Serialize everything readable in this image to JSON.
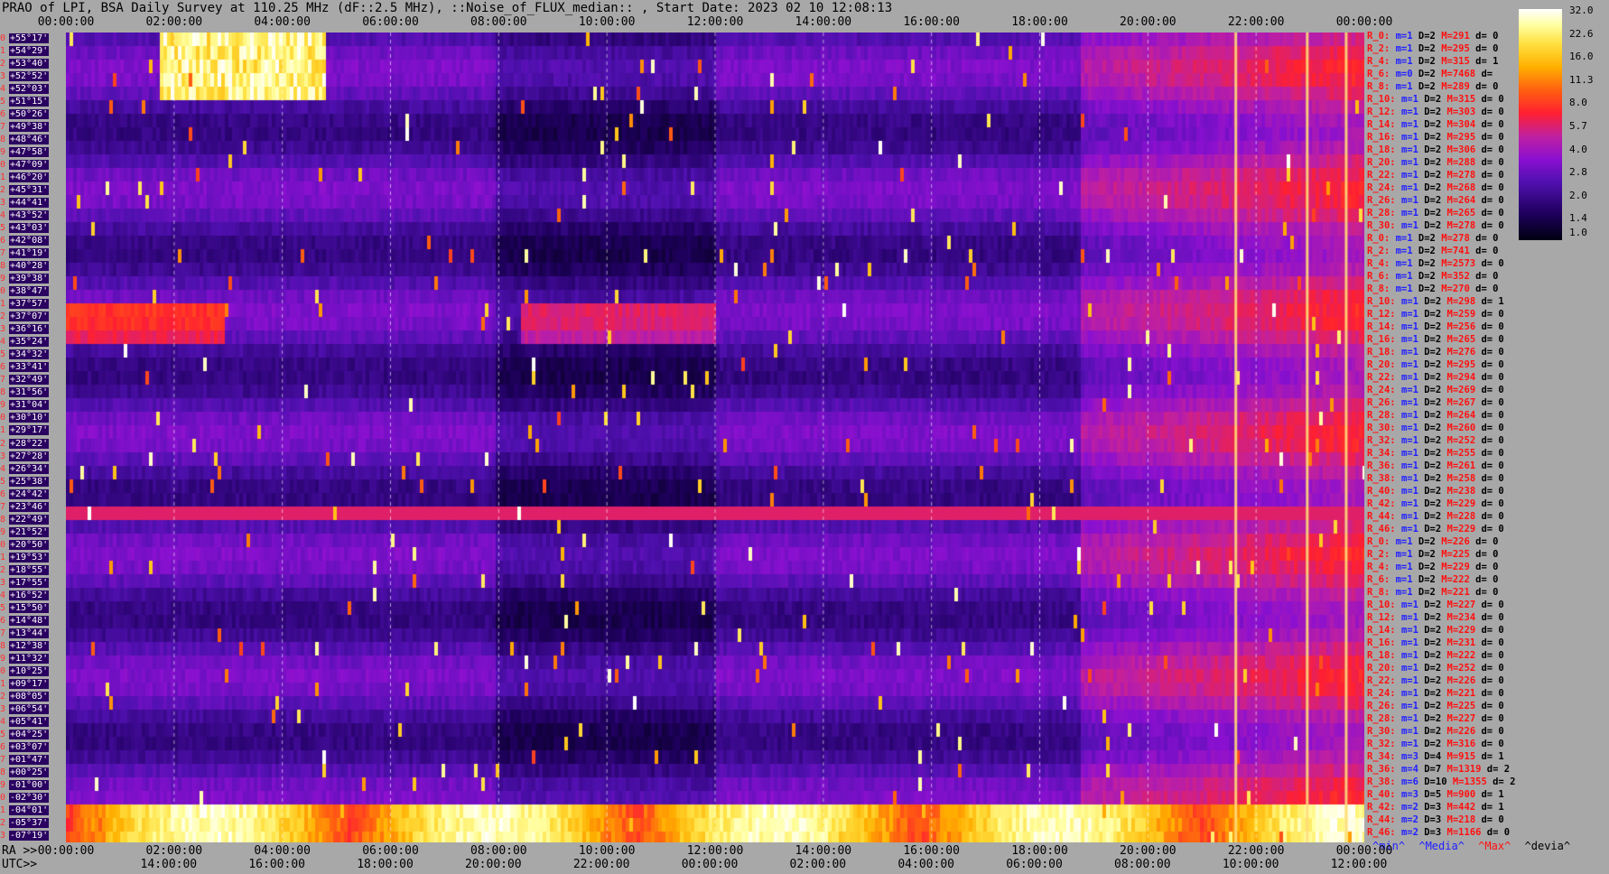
{
  "header": {
    "title": "PRAO of LPI, BSA Daily Survey at 110.25 MHz (dF::2.5 MHz), ::Noise_of_FLUX_median:: , Start Date: 2023 02 10 12:08:13"
  },
  "chart_data": {
    "type": "heatmap",
    "title": "PRAO of LPI, BSA Daily Survey at 110.25 MHz (dF::2.5 MHz), ::Noise_of_FLUX_median:: , Start Date: 2023 02 10 12:08:13",
    "top_time_ticks": [
      "00:00:00",
      "02:00:00",
      "04:00:00",
      "06:00:00",
      "08:00:00",
      "10:00:00",
      "12:00:00",
      "14:00:00",
      "16:00:00",
      "18:00:00",
      "20:00:00",
      "22:00:00",
      "00:00:00"
    ],
    "ra_prefix": "RA >>",
    "ra_ticks": [
      "00:00:00",
      "02:00:00",
      "04:00:00",
      "06:00:00",
      "08:00:00",
      "10:00:00",
      "12:00:00",
      "14:00:00",
      "16:00:00",
      "18:00:00",
      "20:00:00",
      "22:00:00",
      "00:00:00"
    ],
    "utc_prefix": "UTC>>",
    "utc_ticks": [
      "14:00:00",
      "16:00:00",
      "18:00:00",
      "20:00:00",
      "22:00:00",
      "00:00:00",
      "02:00:00",
      "04:00:00",
      "06:00:00",
      "08:00:00",
      "10:00:00",
      "12:00:00"
    ],
    "declinations": [
      "+55°17'",
      "+54°29'",
      "+53°40'",
      "+52°52'",
      "+52°03'",
      "+51°15'",
      "+50°26'",
      "+49°38'",
      "+48°46'",
      "+47°58'",
      "+47°09'",
      "+46°20'",
      "+45°31'",
      "+44°41'",
      "+43°52'",
      "+43°03'",
      "+42°08'",
      "+41°19'",
      "+40°28'",
      "+39°38'",
      "+38°47'",
      "+37°57'",
      "+37°07'",
      "+36°16'",
      "+35°24'",
      "+34°32'",
      "+33°41'",
      "+32°49'",
      "+31°56'",
      "+31°04'",
      "+30°10'",
      "+29°17'",
      "+28°22'",
      "+27°28'",
      "+26°34'",
      "+25°38'",
      "+24°42'",
      "+23°46'",
      "+22°49'",
      "+21°52'",
      "+20°50'",
      "+19°53'",
      "+18°55'",
      "+17°55'",
      "+16°52'",
      "+15°50'",
      "+14°48'",
      "+13°44'",
      "+12°38'",
      "+11°32'",
      "+10°25'",
      "+09°17'",
      "+08°05'",
      "+06°54'",
      "+05°41'",
      "+04°25'",
      "+03°07'",
      "+01°47'",
      "+00°25'",
      "-01°00'",
      "-02°30'",
      "-04°01'",
      "-05°37'",
      "-07°19'"
    ],
    "colorbar": {
      "ticks": [
        "32.0",
        "22.6",
        "16.0",
        "11.3",
        "8.0",
        "5.7",
        "4.0",
        "2.8",
        "2.0",
        "1.4",
        "1.0"
      ],
      "scale": "log"
    },
    "colors": {
      "low": "#000010",
      "mid": "#8a10d0",
      "high": "#ff2030",
      "max": "#ffffff"
    },
    "stats": [
      {
        "r": "R_0:",
        "m": "m=1",
        "d": "D=2",
        "M": "M=291",
        "dv": "d= 0"
      },
      {
        "r": "R_2:",
        "m": "m=1",
        "d": "D=2",
        "M": "M=295",
        "dv": "d= 0"
      },
      {
        "r": "R_4:",
        "m": "m=1",
        "d": "D=2",
        "M": "M=315",
        "dv": "d= 1"
      },
      {
        "r": "R_6:",
        "m": "m=0",
        "d": "D=2",
        "M": "M=7468",
        "dv": "d="
      },
      {
        "r": "R_8:",
        "m": "m=1",
        "d": "D=2",
        "M": "M=289",
        "dv": "d= 0"
      },
      {
        "r": "R_10:",
        "m": "m=1",
        "d": "D=2",
        "M": "M=315",
        "dv": "d= 0"
      },
      {
        "r": "R_12:",
        "m": "m=1",
        "d": "D=2",
        "M": "M=303",
        "dv": "d= 0"
      },
      {
        "r": "R_14:",
        "m": "m=1",
        "d": "D=2",
        "M": "M=304",
        "dv": "d= 0"
      },
      {
        "r": "R_16:",
        "m": "m=1",
        "d": "D=2",
        "M": "M=295",
        "dv": "d= 0"
      },
      {
        "r": "R_18:",
        "m": "m=1",
        "d": "D=2",
        "M": "M=306",
        "dv": "d= 0"
      },
      {
        "r": "R_20:",
        "m": "m=1",
        "d": "D=2",
        "M": "M=288",
        "dv": "d= 0"
      },
      {
        "r": "R_22:",
        "m": "m=1",
        "d": "D=2",
        "M": "M=278",
        "dv": "d= 0"
      },
      {
        "r": "R_24:",
        "m": "m=1",
        "d": "D=2",
        "M": "M=268",
        "dv": "d= 0"
      },
      {
        "r": "R_26:",
        "m": "m=1",
        "d": "D=2",
        "M": "M=264",
        "dv": "d= 0"
      },
      {
        "r": "R_28:",
        "m": "m=1",
        "d": "D=2",
        "M": "M=265",
        "dv": "d= 0"
      },
      {
        "r": "R_30:",
        "m": "m=1",
        "d": "D=2",
        "M": "M=278",
        "dv": "d= 0"
      },
      {
        "r": "R_0:",
        "m": "m=1",
        "d": "D=2",
        "M": "M=278",
        "dv": "d= 0"
      },
      {
        "r": "R_2:",
        "m": "m=1",
        "d": "D=2",
        "M": "M=741",
        "dv": "d= 0"
      },
      {
        "r": "R_4:",
        "m": "m=1",
        "d": "D=2",
        "M": "M=2573",
        "dv": "d= 0"
      },
      {
        "r": "R_6:",
        "m": "m=1",
        "d": "D=2",
        "M": "M=352",
        "dv": "d= 0"
      },
      {
        "r": "R_8:",
        "m": "m=1",
        "d": "D=2",
        "M": "M=270",
        "dv": "d= 0"
      },
      {
        "r": "R_10:",
        "m": "m=1",
        "d": "D=2",
        "M": "M=298",
        "dv": "d= 1"
      },
      {
        "r": "R_12:",
        "m": "m=1",
        "d": "D=2",
        "M": "M=259",
        "dv": "d= 0"
      },
      {
        "r": "R_14:",
        "m": "m=1",
        "d": "D=2",
        "M": "M=256",
        "dv": "d= 0"
      },
      {
        "r": "R_16:",
        "m": "m=1",
        "d": "D=2",
        "M": "M=265",
        "dv": "d= 0"
      },
      {
        "r": "R_18:",
        "m": "m=1",
        "d": "D=2",
        "M": "M=276",
        "dv": "d= 0"
      },
      {
        "r": "R_20:",
        "m": "m=1",
        "d": "D=2",
        "M": "M=295",
        "dv": "d= 0"
      },
      {
        "r": "R_22:",
        "m": "m=1",
        "d": "D=2",
        "M": "M=294",
        "dv": "d= 0"
      },
      {
        "r": "R_24:",
        "m": "m=1",
        "d": "D=2",
        "M": "M=269",
        "dv": "d= 0"
      },
      {
        "r": "R_26:",
        "m": "m=1",
        "d": "D=2",
        "M": "M=267",
        "dv": "d= 0"
      },
      {
        "r": "R_28:",
        "m": "m=1",
        "d": "D=2",
        "M": "M=264",
        "dv": "d= 0"
      },
      {
        "r": "R_30:",
        "m": "m=1",
        "d": "D=2",
        "M": "M=260",
        "dv": "d= 0"
      },
      {
        "r": "R_32:",
        "m": "m=1",
        "d": "D=2",
        "M": "M=252",
        "dv": "d= 0"
      },
      {
        "r": "R_34:",
        "m": "m=1",
        "d": "D=2",
        "M": "M=255",
        "dv": "d= 0"
      },
      {
        "r": "R_36:",
        "m": "m=1",
        "d": "D=2",
        "M": "M=261",
        "dv": "d= 0"
      },
      {
        "r": "R_38:",
        "m": "m=1",
        "d": "D=2",
        "M": "M=258",
        "dv": "d= 0"
      },
      {
        "r": "R_40:",
        "m": "m=1",
        "d": "D=2",
        "M": "M=238",
        "dv": "d= 0"
      },
      {
        "r": "R_42:",
        "m": "m=1",
        "d": "D=2",
        "M": "M=229",
        "dv": "d= 0"
      },
      {
        "r": "R_44:",
        "m": "m=1",
        "d": "D=2",
        "M": "M=228",
        "dv": "d= 0"
      },
      {
        "r": "R_46:",
        "m": "m=1",
        "d": "D=2",
        "M": "M=229",
        "dv": "d= 0"
      },
      {
        "r": "R_0:",
        "m": "m=1",
        "d": "D=2",
        "M": "M=226",
        "dv": "d= 0"
      },
      {
        "r": "R_2:",
        "m": "m=1",
        "d": "D=2",
        "M": "M=225",
        "dv": "d= 0"
      },
      {
        "r": "R_4:",
        "m": "m=1",
        "d": "D=2",
        "M": "M=229",
        "dv": "d= 0"
      },
      {
        "r": "R_6:",
        "m": "m=1",
        "d": "D=2",
        "M": "M=222",
        "dv": "d= 0"
      },
      {
        "r": "R_8:",
        "m": "m=1",
        "d": "D=2",
        "M": "M=221",
        "dv": "d= 0"
      },
      {
        "r": "R_10:",
        "m": "m=1",
        "d": "D=2",
        "M": "M=227",
        "dv": "d= 0"
      },
      {
        "r": "R_12:",
        "m": "m=1",
        "d": "D=2",
        "M": "M=234",
        "dv": "d= 0"
      },
      {
        "r": "R_14:",
        "m": "m=1",
        "d": "D=2",
        "M": "M=229",
        "dv": "d= 0"
      },
      {
        "r": "R_16:",
        "m": "m=1",
        "d": "D=2",
        "M": "M=231",
        "dv": "d= 0"
      },
      {
        "r": "R_18:",
        "m": "m=1",
        "d": "D=2",
        "M": "M=222",
        "dv": "d= 0"
      },
      {
        "r": "R_20:",
        "m": "m=1",
        "d": "D=2",
        "M": "M=252",
        "dv": "d= 0"
      },
      {
        "r": "R_22:",
        "m": "m=1",
        "d": "D=2",
        "M": "M=226",
        "dv": "d= 0"
      },
      {
        "r": "R_24:",
        "m": "m=1",
        "d": "D=2",
        "M": "M=221",
        "dv": "d= 0"
      },
      {
        "r": "R_26:",
        "m": "m=1",
        "d": "D=2",
        "M": "M=225",
        "dv": "d= 0"
      },
      {
        "r": "R_28:",
        "m": "m=1",
        "d": "D=2",
        "M": "M=227",
        "dv": "d= 0"
      },
      {
        "r": "R_30:",
        "m": "m=1",
        "d": "D=2",
        "M": "M=226",
        "dv": "d= 0"
      },
      {
        "r": "R_32:",
        "m": "m=1",
        "d": "D=2",
        "M": "M=316",
        "dv": "d= 0"
      },
      {
        "r": "R_34:",
        "m": "m=3",
        "d": "D=4",
        "M": "M=915",
        "dv": "d= 1"
      },
      {
        "r": "R_36:",
        "m": "m=4",
        "d": "D=7",
        "M": "M=1319",
        "dv": "d= 2"
      },
      {
        "r": "R_38:",
        "m": "m=6",
        "d": "D=10",
        "M": "M=1355",
        "dv": "d= 2"
      },
      {
        "r": "R_40:",
        "m": "m=3",
        "d": "D=5",
        "M": "M=900",
        "dv": "d= 1"
      },
      {
        "r": "R_42:",
        "m": "m=2",
        "d": "D=3",
        "M": "M=442",
        "dv": "d= 1"
      },
      {
        "r": "R_44:",
        "m": "m=2",
        "d": "D=3",
        "M": "M=218",
        "dv": "d= 0"
      },
      {
        "r": "R_46:",
        "m": "m=2",
        "d": "D=3",
        "M": "M=1166",
        "dv": "d= 0"
      }
    ],
    "stats_legend": [
      "^min^",
      "^Media^",
      "^Max^",
      "^devia^"
    ]
  }
}
